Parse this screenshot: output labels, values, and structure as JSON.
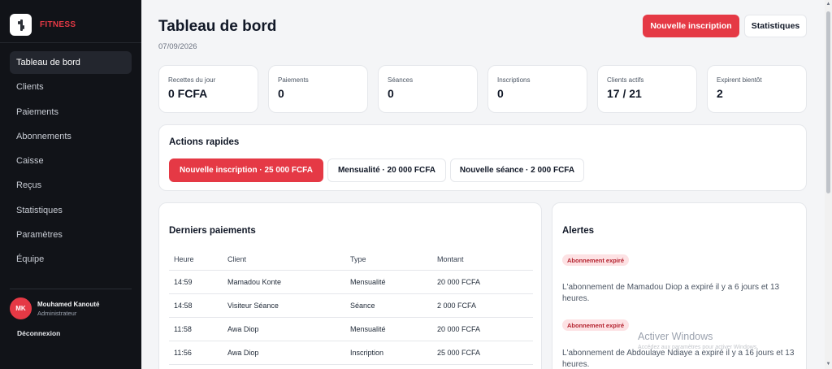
{
  "brand": {
    "name": "FITNESS",
    "logo_icon": "dumbbell-icon"
  },
  "nav": [
    {
      "label": "Tableau de bord",
      "active": true
    },
    {
      "label": "Clients"
    },
    {
      "label": "Paiements"
    },
    {
      "label": "Abonnements"
    },
    {
      "label": "Caisse"
    },
    {
      "label": "Reçus"
    },
    {
      "label": "Statistiques"
    },
    {
      "label": "Paramètres"
    },
    {
      "label": "Équipe"
    }
  ],
  "user": {
    "initials": "MK",
    "name": "Mouhamed Kanouté",
    "role": "Administrateur"
  },
  "logout_label": "Déconnexion",
  "header": {
    "title": "Tableau de bord",
    "date": "07/09/2026",
    "primary_button": "Nouvelle inscription",
    "secondary_button": "Statistiques"
  },
  "stats": [
    {
      "label": "Recettes du jour",
      "value": "0 FCFA"
    },
    {
      "label": "Paiements",
      "value": "0"
    },
    {
      "label": "Séances",
      "value": "0"
    },
    {
      "label": "Inscriptions",
      "value": "0"
    },
    {
      "label": "Clients actifs",
      "value": "17 / 21"
    },
    {
      "label": "Expirent bientôt",
      "value": "2"
    }
  ],
  "quick_actions": {
    "title": "Actions rapides",
    "items": [
      {
        "label": "Nouvelle inscription · 25 000 FCFA",
        "primary": true
      },
      {
        "label": "Mensualité · 20 000 FCFA"
      },
      {
        "label": "Nouvelle séance · 2 000 FCFA"
      }
    ]
  },
  "payments": {
    "title": "Derniers paiements",
    "columns": [
      "Heure",
      "Client",
      "Type",
      "Montant"
    ],
    "rows": [
      [
        "14:59",
        "Mamadou Konte",
        "Mensualité",
        "20 000 FCFA"
      ],
      [
        "14:58",
        "Visiteur Séance",
        "Séance",
        "2 000 FCFA"
      ],
      [
        "11:58",
        "Awa Diop",
        "Mensualité",
        "20 000 FCFA"
      ],
      [
        "11:56",
        "Awa Diop",
        "Inscription",
        "25 000 FCFA"
      ]
    ]
  },
  "alerts": {
    "title": "Alertes",
    "items": [
      {
        "badge": "Abonnement expiré",
        "text": "L'abonnement de Mamadou Diop a expiré il y a 6 jours et 13 heures."
      },
      {
        "badge": "Abonnement expiré",
        "text": "L'abonnement de Abdoulaye Ndiaye a expiré il y a 16 jours et 13 heures."
      }
    ]
  },
  "watermark": {
    "title": "Activer Windows",
    "subtitle": "Accédez aux paramètres pour activer Windows."
  },
  "colors": {
    "accent": "#e53945",
    "sidebar_bg": "#111318",
    "page_bg": "#f4f5f7"
  }
}
